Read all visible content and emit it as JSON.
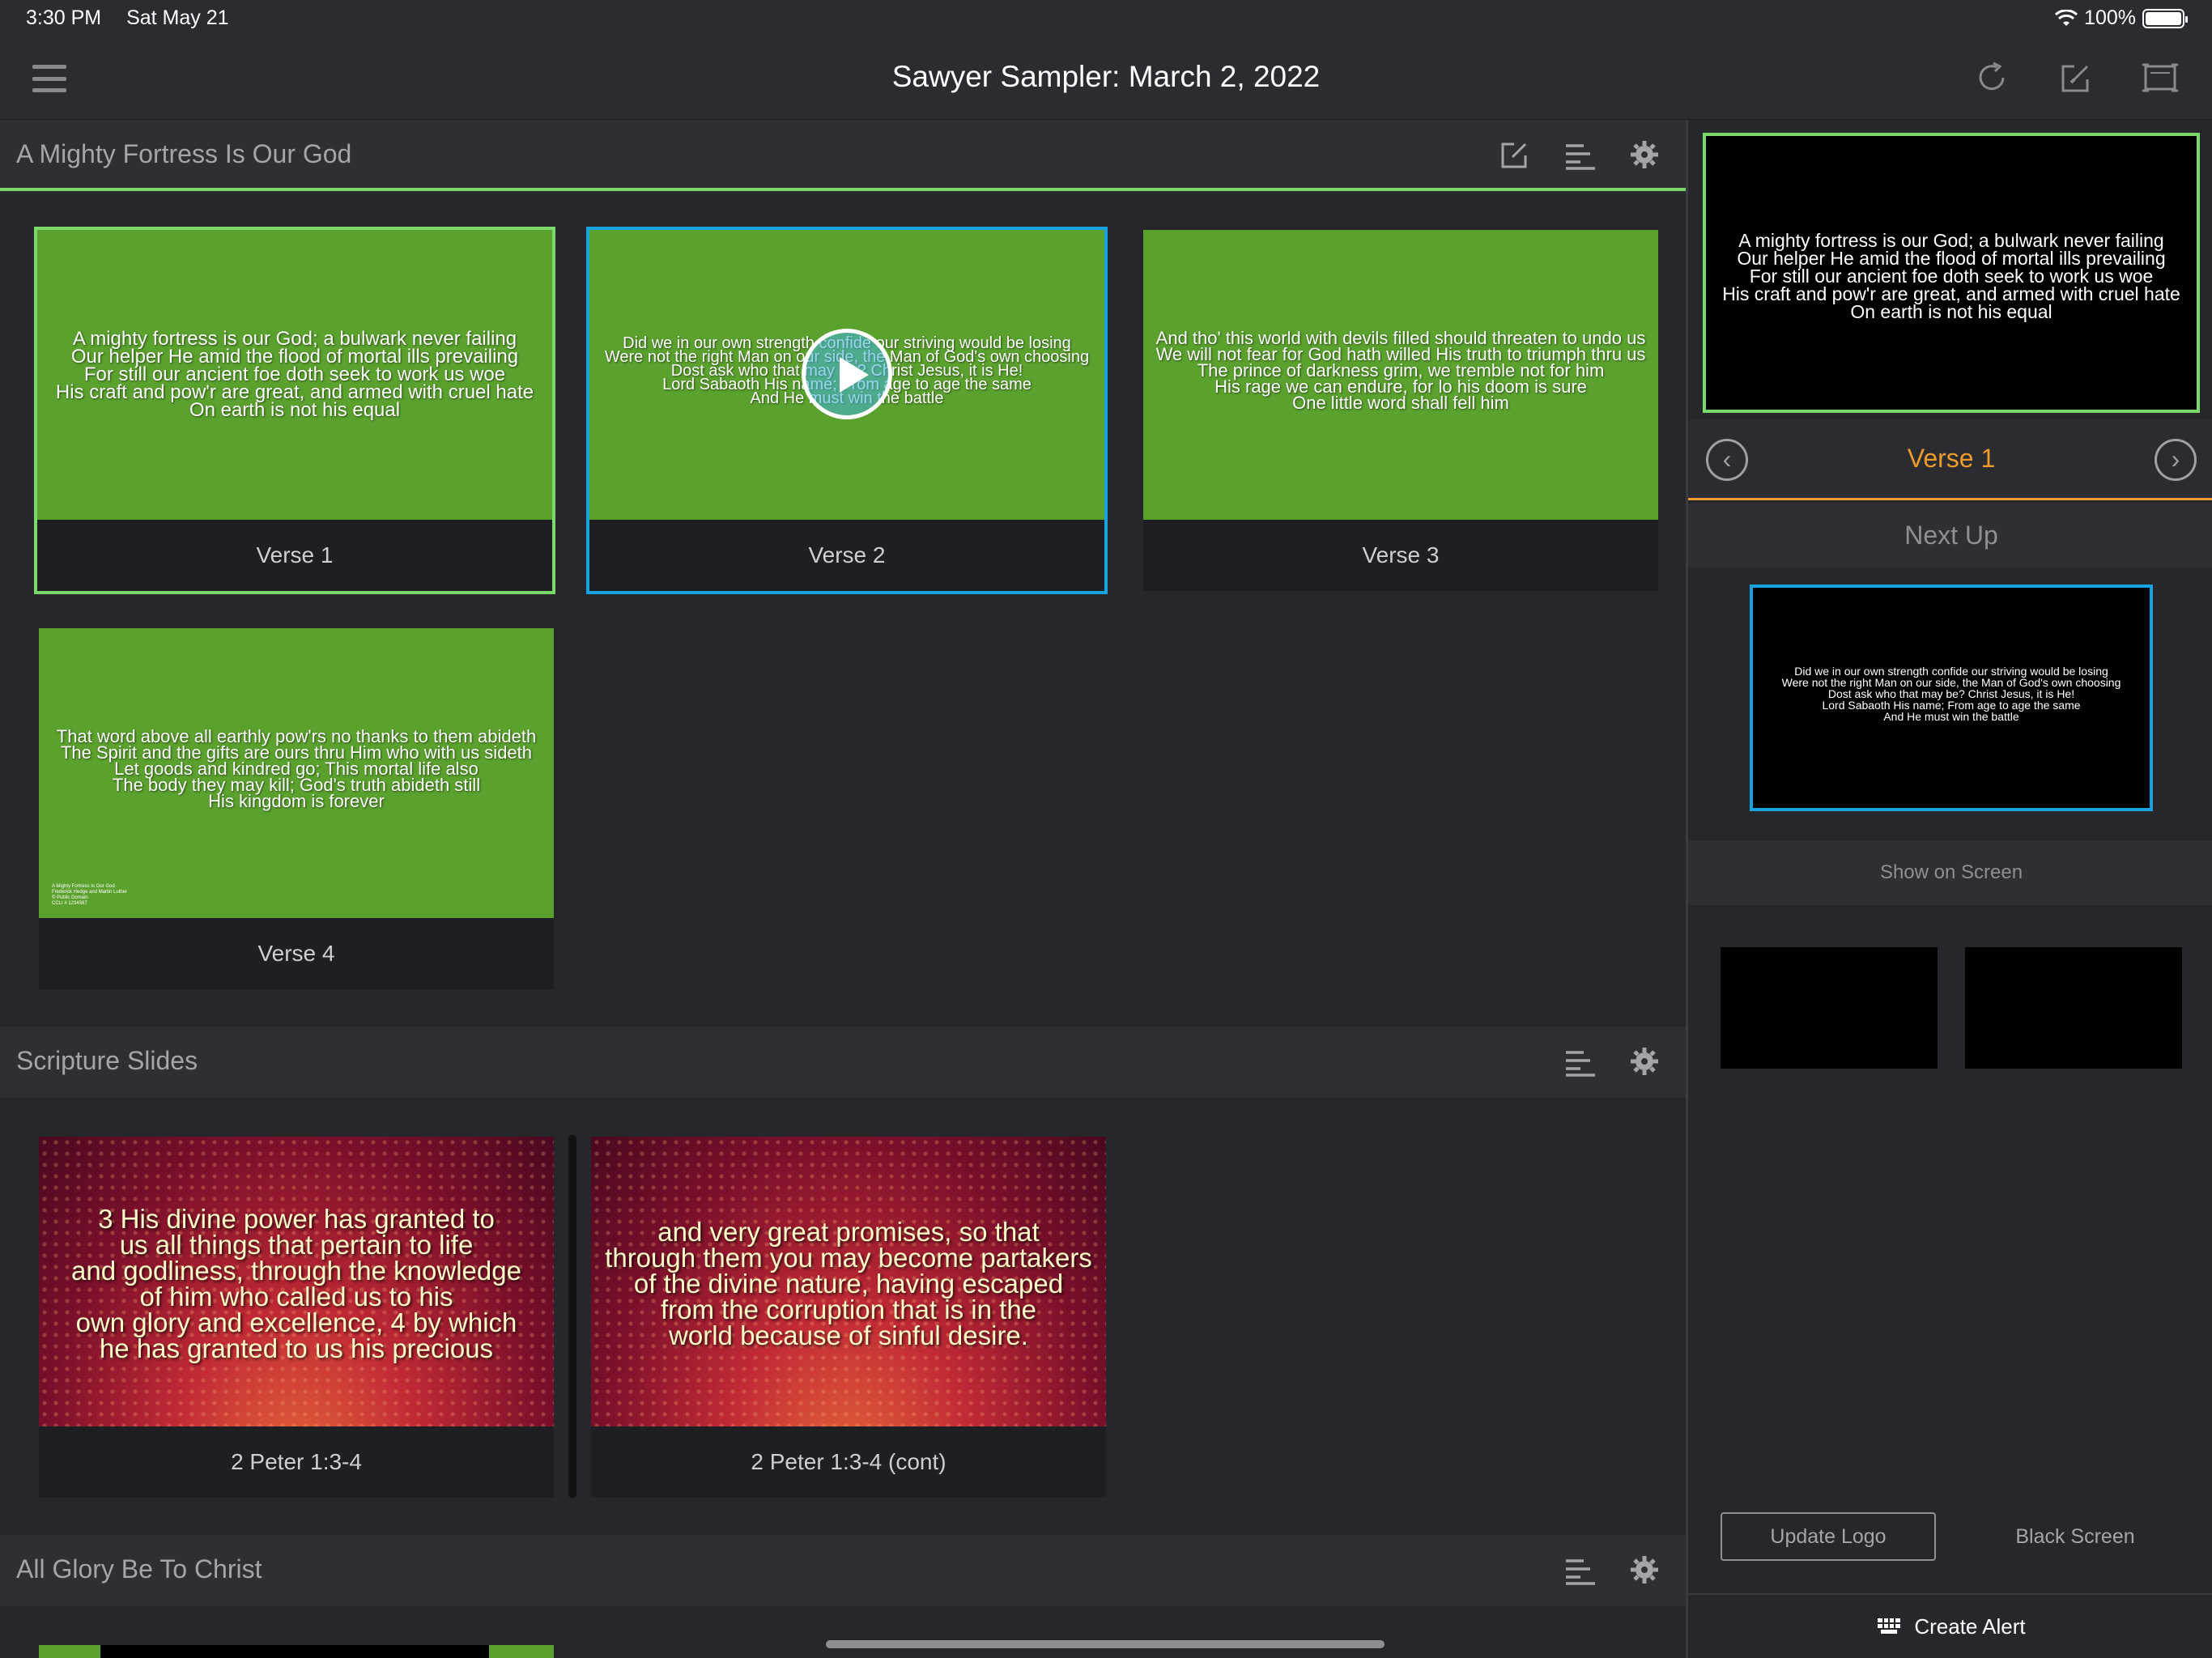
{
  "status_bar": {
    "time": "3:30 PM",
    "date": "Sat May 21",
    "battery": "100%"
  },
  "nav": {
    "title": "Sawyer Sampler: March 2, 2022"
  },
  "sections": {
    "fortress": {
      "title": "A Mighty Fortress Is Our God",
      "slides": [
        {
          "label": "Verse 1",
          "text": "A mighty fortress is our God; a bulwark never failing\nOur helper He amid the flood of mortal ills prevailing\nFor still our ancient foe doth seek to work us woe\nHis craft and pow'r are great, and armed with cruel hate\nOn earth is not his equal"
        },
        {
          "label": "Verse 2",
          "text": "Did we in our own strength confide our striving would be losing\nWere not the right Man on our side, the Man of God's own choosing\nDost ask who that may be? Christ Jesus, it is He!\nLord Sabaoth His name; From age to age the same\nAnd He must win the battle"
        },
        {
          "label": "Verse 3",
          "text": "And tho' this world with devils filled should threaten to undo us\nWe will not fear for God hath willed His truth to triumph thru us\nThe prince of darkness grim, we tremble not for him\nHis rage we can endure, for lo his doom is sure\nOne little word shall fell him"
        },
        {
          "label": "Verse 4",
          "text": "That word above all earthly pow'rs no thanks to them abideth\nThe Spirit and the gifts are ours thru Him who with us sideth\nLet goods and kindred go; This mortal life also\nThe body they may kill; God's truth abideth still\nHis kingdom is forever",
          "fine_print": "A Mighty Fortress Is Our God\nFrederick Hedge and Martin Luther\n© Public Domain\nCCLI # 1234567"
        }
      ]
    },
    "scripture": {
      "title": "Scripture Slides",
      "slides": [
        {
          "label": "2 Peter 1:3-4",
          "text": "3 His divine power has granted to\nus all things that pertain to life\nand godliness, through the knowledge\nof him who called us to his\nown glory and excellence, 4 by which\nhe has granted to us his precious"
        },
        {
          "label": "2 Peter 1:3-4 (cont)",
          "text": "and very great promises, so that\nthrough them you may become partakers\nof the divine nature, having escaped\nfrom the corruption that is in the\nworld because of sinful desire."
        }
      ]
    },
    "glory": {
      "title": "All Glory Be To Christ"
    }
  },
  "right_panel": {
    "preview_text": "A mighty fortress is our God; a bulwark never failing\nOur helper He amid the flood of mortal ills prevailing\nFor still our ancient foe doth seek to work us woe\nHis craft and pow'r are great, and armed with cruel hate\nOn earth is not his equal",
    "current_slide": "Verse 1",
    "next_up_label": "Next Up",
    "next_up_text": "Did we in our own strength confide our striving would be losing\nWere not the right Man on our side, the Man of God's own choosing\nDost ask who that may be? Christ Jesus, it is He!\nLord Sabaoth His name; From age to age the same\nAnd He must win the battle",
    "show_on_screen": "Show on Screen",
    "update_logo": "Update Logo",
    "black_screen": "Black Screen",
    "create_alert": "Create Alert"
  },
  "colors": {
    "accent_green": "#7bd86a",
    "accent_blue": "#18a3e0",
    "accent_orange": "#ef9a2c",
    "slide_green": "#5aa12e"
  },
  "icons": [
    "menu-icon",
    "refresh-icon",
    "edit-icon",
    "present-icon",
    "settings-icon",
    "arrange-icon",
    "keyboard-icon",
    "play-icon",
    "chevron-left-icon",
    "chevron-right-icon"
  ]
}
